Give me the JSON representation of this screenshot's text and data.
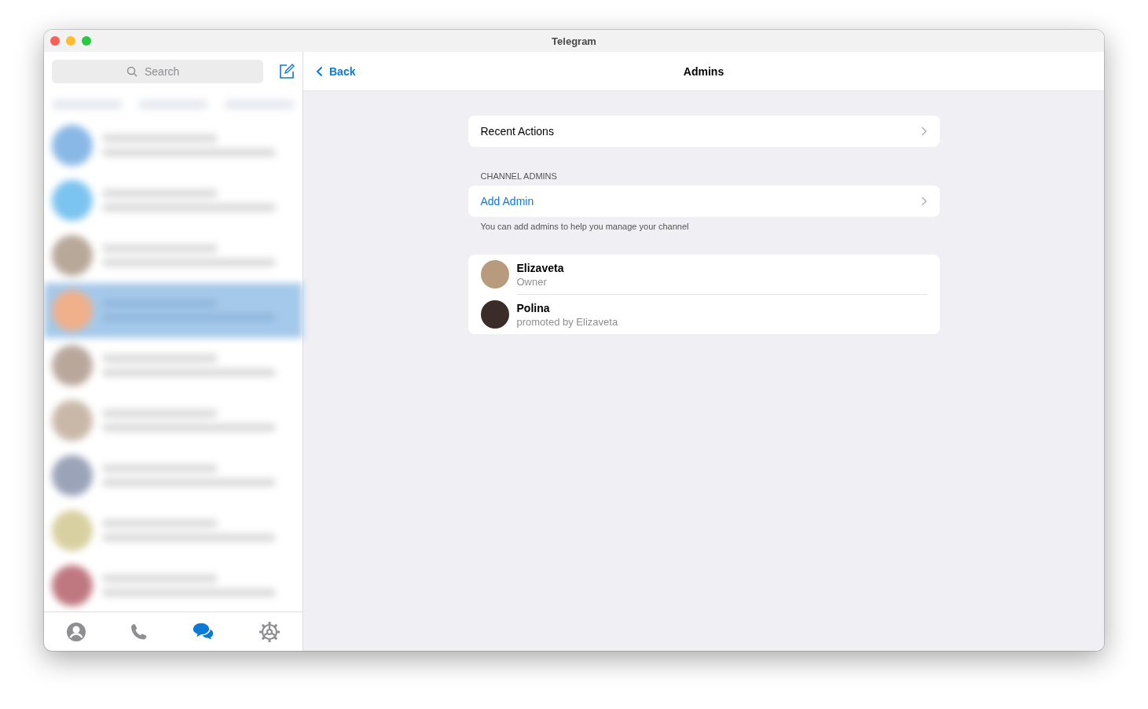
{
  "window": {
    "title": "Telegram"
  },
  "sidebar": {
    "search": {
      "placeholder": "Search"
    },
    "chats": [
      {
        "selected": false,
        "color": "#8ab8e6"
      },
      {
        "selected": false,
        "color": "#7cc4f0"
      },
      {
        "selected": false,
        "color": "#b8a89a"
      },
      {
        "selected": true,
        "color": "#f0b08a"
      },
      {
        "selected": false,
        "color": "#b9a79c"
      },
      {
        "selected": false,
        "color": "#c9b8a8"
      },
      {
        "selected": false,
        "color": "#9aa3b8"
      },
      {
        "selected": false,
        "color": "#d8d0a0"
      },
      {
        "selected": false,
        "color": "#c07880"
      }
    ],
    "tabs": [
      {
        "kind": "contacts",
        "selected": false
      },
      {
        "kind": "calls",
        "selected": false
      },
      {
        "kind": "chats",
        "selected": true
      },
      {
        "kind": "settings",
        "selected": false
      }
    ]
  },
  "header": {
    "back": "Back",
    "title": "Admins"
  },
  "recent_actions": "Recent Actions",
  "section_title": "CHANNEL ADMINS",
  "add_admin": "Add Admin",
  "hint": "You can add admins to help you manage your channel",
  "admins": [
    {
      "name": "Elizaveta",
      "role": "Owner",
      "color": "#b89a7c"
    },
    {
      "name": "Polina",
      "role": "promoted by Elizaveta",
      "color": "#3a2c28"
    }
  ]
}
